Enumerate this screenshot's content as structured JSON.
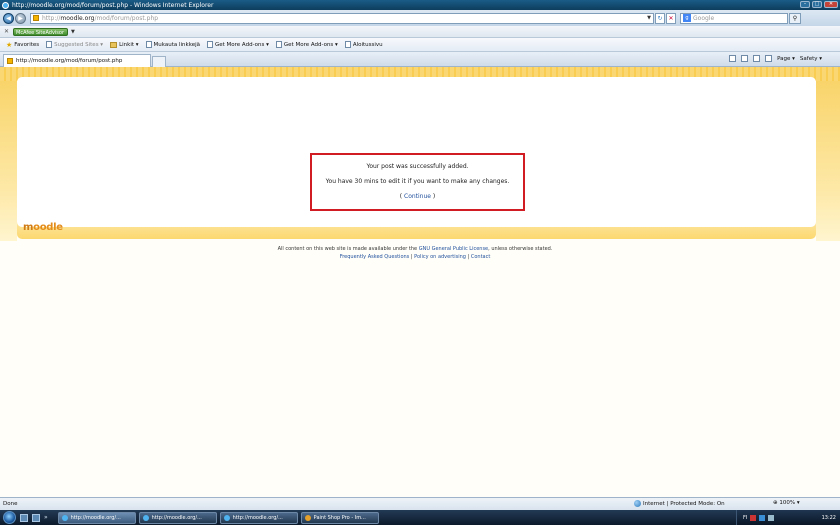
{
  "window": {
    "title": "http://moodle.org/mod/forum/post.php - Windows Internet Explorer",
    "minimize": "–",
    "maximize": "□",
    "close": "✕"
  },
  "address_bar": {
    "url_prefix": "http://",
    "url_host": "moodle.org",
    "url_path": "/mod/forum/post.php",
    "search_placeholder": "Google"
  },
  "mcafee": {
    "close_label": "✕",
    "badge": "McAfee SiteAdvisor"
  },
  "favorites_bar": {
    "favorites_label": "Favorites",
    "items": [
      {
        "label": "Suggested Sites ▾",
        "faded": true
      },
      {
        "label": "Linkit ▾"
      },
      {
        "label": "Mukauta linkkejä"
      },
      {
        "label": "Get More Add-ons ▾"
      },
      {
        "label": "Get More Add-ons ▾"
      },
      {
        "label": "Aloitussivu"
      }
    ]
  },
  "tab": {
    "label": "http://moodle.org/mod/forum/post.php"
  },
  "command_bar": {
    "page_label": "Page ▾",
    "safety_label": "Safety ▾"
  },
  "message": {
    "line1": "Your post was successfully added.",
    "line2": "You have 30 mins to edit it if you want to make any changes.",
    "continue_prefix": "( ",
    "continue_link": "Continue",
    "continue_suffix": " )"
  },
  "footer": {
    "logo_m": "m",
    "logo_rest": "oodle",
    "license_pre": "All content on this web site is made available under the ",
    "license_link": "GNU General Public License",
    "license_post": ", unless otherwise stated.",
    "link_faq": "Frequently Asked Questions",
    "link_policy": "Policy on advertising",
    "link_contact": "Contact",
    "separator": " | "
  },
  "status_bar": {
    "status": "Done",
    "zone": "Internet | Protected Mode: On",
    "zoom": "⊕ 100% ▾"
  },
  "taskbar": {
    "more": "»",
    "tasks": [
      {
        "label": "http://moodle.org/...",
        "active": true
      },
      {
        "label": "http://moodle.org/..."
      },
      {
        "label": "http://moodle.org/..."
      },
      {
        "label": "Paint Shop Pro - Im..."
      }
    ],
    "lang": "FI",
    "clock": "13:22"
  },
  "colors": {
    "highlight_border": "#d11c23",
    "link": "#1f4f9c",
    "moodle_orange": "#e38c1a",
    "header_yellow": "#f9cd52"
  }
}
